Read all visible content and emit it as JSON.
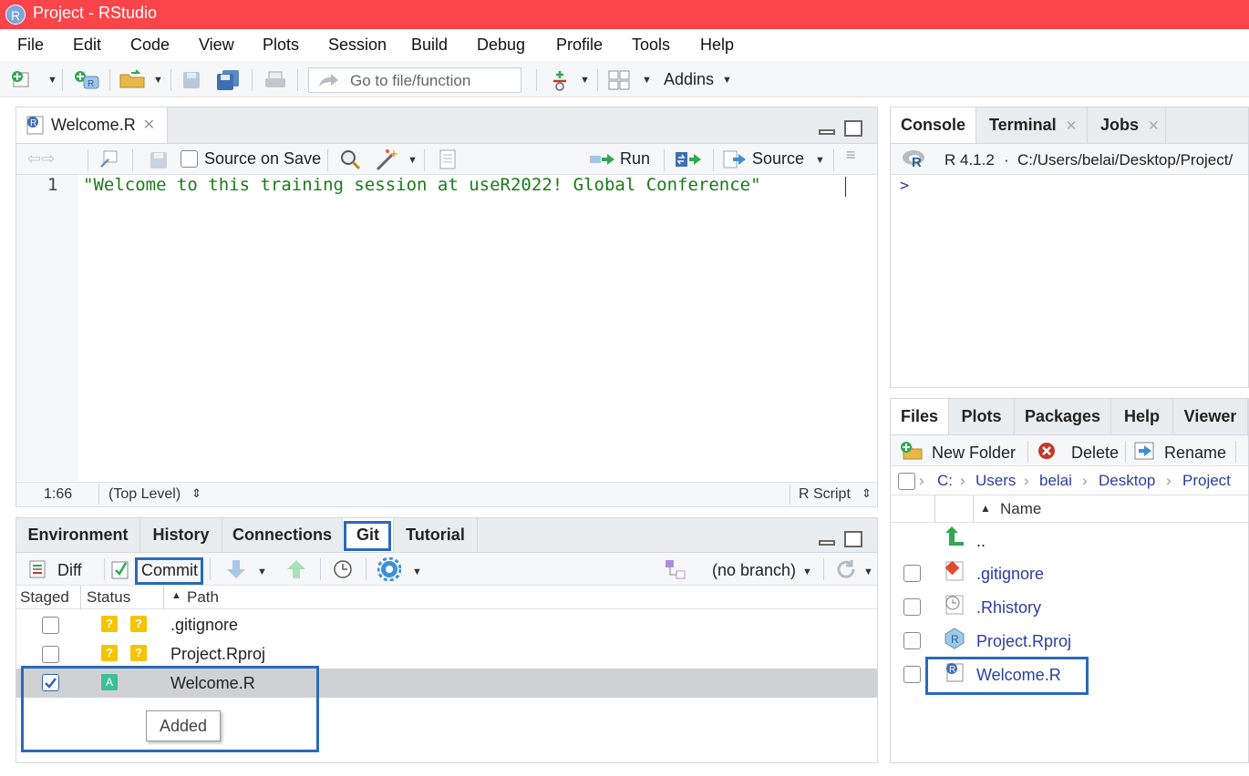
{
  "window": {
    "title": "Project - RStudio",
    "logo_letter": "R"
  },
  "menu": [
    "File",
    "Edit",
    "Code",
    "View",
    "Plots",
    "Session",
    "Build",
    "Debug",
    "Profile",
    "Tools",
    "Help"
  ],
  "toolbar": {
    "goto_placeholder": "Go to file/function",
    "addins_label": "Addins"
  },
  "editor": {
    "tab_label": "Welcome.R",
    "source_on_save_label": "Source on Save",
    "run_label": "Run",
    "source_label": "Source",
    "lines": [
      {
        "num": "1",
        "text": "\"Welcome to this training session at useR2022! Global Conference\""
      }
    ],
    "status_position": "1:66",
    "status_scope": "(Top Level)",
    "status_filetype": "R Script"
  },
  "console": {
    "tabs": [
      "Console",
      "Terminal",
      "Jobs"
    ],
    "version": "R 4.1.2",
    "separator": "·",
    "path": "C:/Users/belai/Desktop/Project/",
    "prompt": ">"
  },
  "env_pane": {
    "tabs": [
      "Environment",
      "History",
      "Connections",
      "Git",
      "Tutorial"
    ],
    "diff_label": "Diff",
    "commit_label": "Commit",
    "branch_label": "(no branch)",
    "columns": {
      "staged": "Staged",
      "status": "Status",
      "path": "Path"
    },
    "rows": [
      {
        "path": ".gitignore",
        "status": [
          "?",
          "?"
        ],
        "staged": false
      },
      {
        "path": "Project.Rproj",
        "status": [
          "?",
          "?"
        ],
        "staged": false
      },
      {
        "path": "Welcome.R",
        "status": [
          "A"
        ],
        "staged": true
      }
    ],
    "tooltip": "Added"
  },
  "files_pane": {
    "tabs": [
      "Files",
      "Plots",
      "Packages",
      "Help",
      "Viewer"
    ],
    "new_folder_label": "New Folder",
    "delete_label": "Delete",
    "rename_label": "Rename",
    "breadcrumb": [
      "C:",
      "Users",
      "belai",
      "Desktop",
      "Project"
    ],
    "name_col": "Name",
    "up_label": "..",
    "files": [
      ".gitignore",
      ".Rhistory",
      "Project.Rproj",
      "Welcome.R"
    ]
  },
  "colors": {
    "titlebar": "#f9454a",
    "highlight": "#2a6ab8",
    "link": "#2a3ea3",
    "code": "#187c18"
  }
}
